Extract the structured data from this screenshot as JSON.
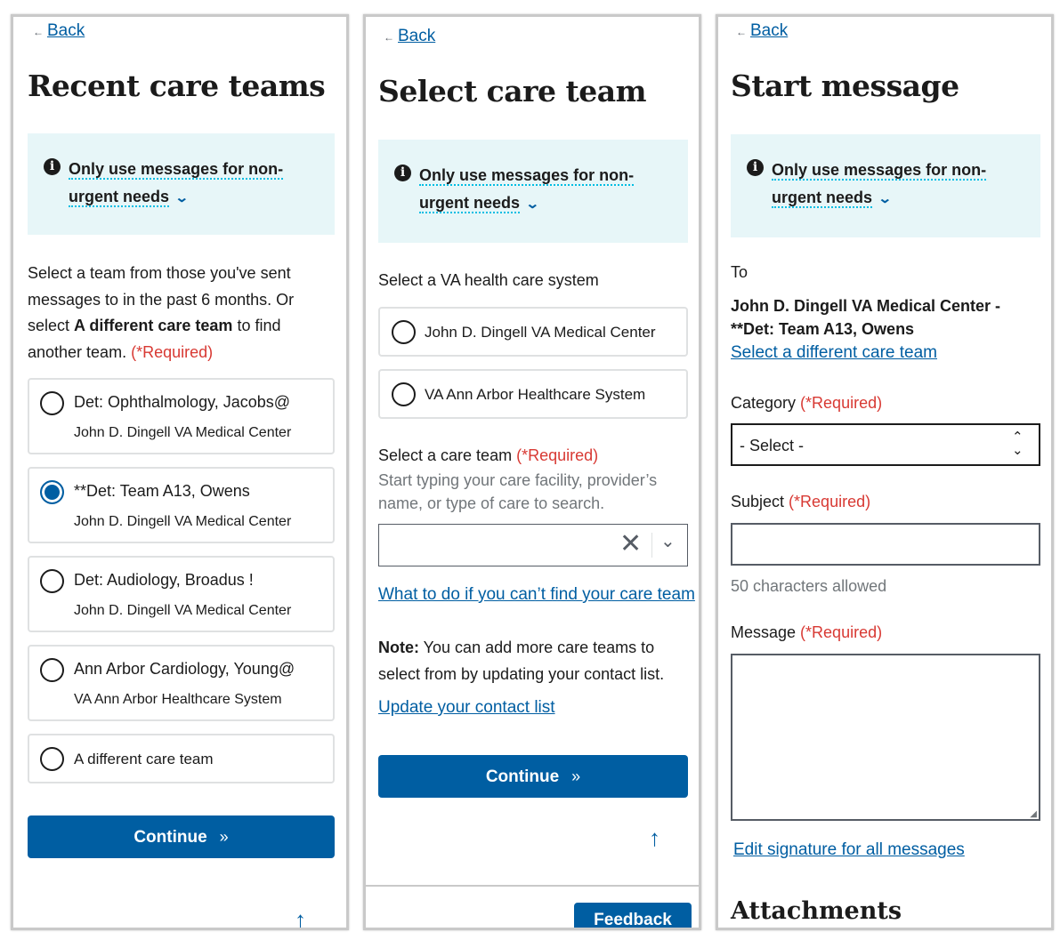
{
  "panel1": {
    "back": "Back",
    "title": "Recent care teams",
    "alert_line1": "Only use messages for non-",
    "alert_line2": "urgent needs",
    "intro_line1": "Select a team from those you've sent",
    "intro_line2": "messages to in the past 6 months. Or",
    "intro_line3_pre": "select ",
    "intro_line3_bold": "A different care team",
    "intro_line3_post": " to find",
    "intro_line4": "another team. ",
    "required": "(*Required)",
    "options": [
      {
        "label": "Det: Ophthalmology, Jacobs@",
        "facility": "John D. Dingell VA Medical Center",
        "checked": false
      },
      {
        "label": "**Det: Team A13, Owens",
        "facility": "John D. Dingell VA Medical Center",
        "checked": true
      },
      {
        "label": "Det: Audiology, Broadus !",
        "facility": "John D. Dingell VA Medical Center",
        "checked": false
      },
      {
        "label": "Ann Arbor Cardiology, Young@",
        "facility": "VA Ann Arbor Healthcare System",
        "checked": false
      },
      {
        "label": "A different care team",
        "facility": "",
        "checked": false
      }
    ],
    "continue": "Continue"
  },
  "panel2": {
    "back": "Back",
    "title": "Select care team",
    "alert_line1": "Only use messages for non-",
    "alert_line2": "urgent needs",
    "system_label": "Select a VA health care system",
    "systems": [
      "John D. Dingell VA Medical Center",
      "VA Ann Arbor Healthcare System"
    ],
    "team_label": "Select a care team ",
    "required": "(*Required)",
    "hint_line1": "Start typing your care facility, provider’s",
    "hint_line2": "name, or type of care to search.",
    "help_link": "What to do if you can’t find your care team",
    "note_bold": "Note:",
    "note_line1": " You can add more care teams to",
    "note_line2": "select from by updating your contact list.",
    "update_link": "Update your contact list",
    "continue": "Continue",
    "feedback": "Feedback"
  },
  "panel3": {
    "back": "Back",
    "title": "Start message",
    "alert_line1": "Only use messages for non-",
    "alert_line2": "urgent needs",
    "to_label": "To",
    "recipient_line1": "John D. Dingell VA Medical Center -",
    "recipient_line2": "**Det: Team A13, Owens",
    "change_link": "Select a different care team",
    "category_label": "Category ",
    "required": "(*Required)",
    "category_value": "- Select -",
    "subject_label": "Subject ",
    "subject_hint": "50 characters allowed",
    "message_label": "Message ",
    "signature_link": "Edit signature for all messages",
    "attachments": "Attachments"
  }
}
